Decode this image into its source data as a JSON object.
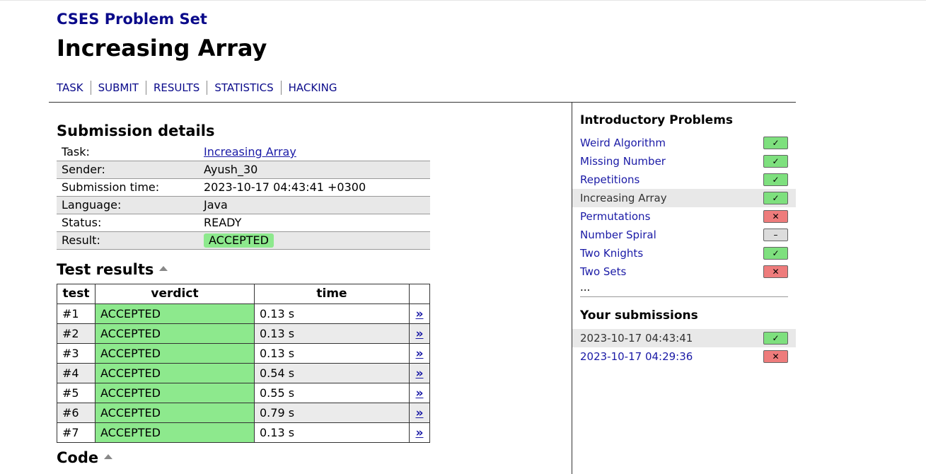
{
  "site": {
    "title": "CSES Problem Set"
  },
  "page": {
    "title": "Increasing Array"
  },
  "nav": [
    "TASK",
    "SUBMIT",
    "RESULTS",
    "STATISTICS",
    "HACKING"
  ],
  "submission": {
    "heading": "Submission details",
    "rows": [
      {
        "label": "Task:",
        "value": "Increasing Array",
        "link": true
      },
      {
        "label": "Sender:",
        "value": "Ayush_30"
      },
      {
        "label": "Submission time:",
        "value": "2023-10-17 04:43:41 +0300"
      },
      {
        "label": "Language:",
        "value": "Java"
      },
      {
        "label": "Status:",
        "value": "READY"
      },
      {
        "label": "Result:",
        "value": "ACCEPTED",
        "badge": true
      }
    ]
  },
  "tests": {
    "heading": "Test results",
    "columns": [
      "test",
      "verdict",
      "time",
      ""
    ],
    "link_symbol": "»",
    "rows": [
      {
        "test": "#1",
        "verdict": "ACCEPTED",
        "time": "0.13 s"
      },
      {
        "test": "#2",
        "verdict": "ACCEPTED",
        "time": "0.13 s"
      },
      {
        "test": "#3",
        "verdict": "ACCEPTED",
        "time": "0.13 s"
      },
      {
        "test": "#4",
        "verdict": "ACCEPTED",
        "time": "0.54 s"
      },
      {
        "test": "#5",
        "verdict": "ACCEPTED",
        "time": "0.55 s"
      },
      {
        "test": "#6",
        "verdict": "ACCEPTED",
        "time": "0.79 s"
      },
      {
        "test": "#7",
        "verdict": "ACCEPTED",
        "time": "0.13 s"
      }
    ]
  },
  "code": {
    "heading": "Code"
  },
  "sidebar": {
    "section_title": "Introductory Problems",
    "problems": [
      {
        "name": "Weird Algorithm",
        "status": "ok",
        "icon": "✓"
      },
      {
        "name": "Missing Number",
        "status": "ok",
        "icon": "✓"
      },
      {
        "name": "Repetitions",
        "status": "ok",
        "icon": "✓"
      },
      {
        "name": "Increasing Array",
        "status": "ok",
        "icon": "✓",
        "current": true
      },
      {
        "name": "Permutations",
        "status": "bad",
        "icon": "✕"
      },
      {
        "name": "Number Spiral",
        "status": "none",
        "icon": "–"
      },
      {
        "name": "Two Knights",
        "status": "ok",
        "icon": "✓"
      },
      {
        "name": "Two Sets",
        "status": "bad",
        "icon": "✕"
      }
    ],
    "more": "...",
    "submissions_title": "Your submissions",
    "submissions": [
      {
        "time": "2023-10-17 04:43:41",
        "status": "ok",
        "icon": "✓",
        "current": true
      },
      {
        "time": "2023-10-17 04:29:36",
        "status": "bad",
        "icon": "✕"
      }
    ]
  },
  "colors": {
    "accepted": "#8de98d",
    "status_ok": "#7ee07e",
    "status_bad": "#ee7c7c",
    "status_none": "#dcdcdc",
    "link": "#1a1aa6",
    "title": "#0a0a8a"
  }
}
